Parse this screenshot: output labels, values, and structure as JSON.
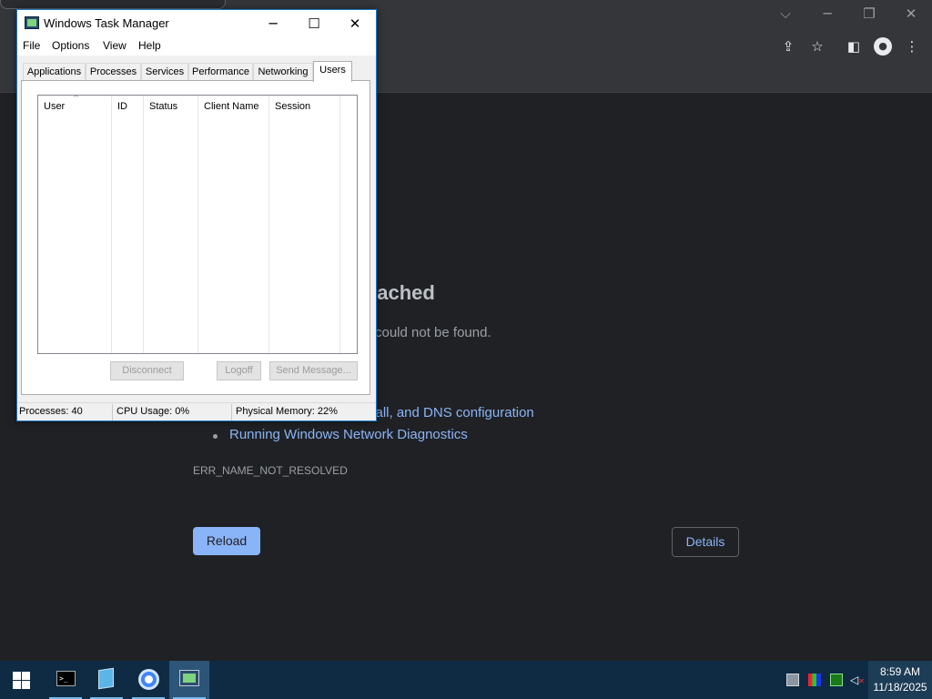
{
  "browser": {
    "window_controls": {
      "chevron": "⌵",
      "minimize": "─",
      "restore": "❐",
      "close": "✕"
    },
    "toolbar_icons": {
      "share": "⇪",
      "star": "☆",
      "sidebar": "◧",
      "profile": "●",
      "menu": "⋮"
    },
    "error": {
      "title_partial": "eached",
      "subtitle_partial": "could not be found.",
      "check_item_partial": "vall, and DNS configuration",
      "diagnostics_link": "Running Windows Network Diagnostics",
      "error_code": "ERR_NAME_NOT_RESOLVED",
      "reload_label": "Reload",
      "details_label": "Details"
    }
  },
  "task_manager": {
    "title": "Windows Task Manager",
    "controls": {
      "minimize": "─",
      "maximize": "☐",
      "close": "✕"
    },
    "menu": [
      "File",
      "Options",
      "View",
      "Help"
    ],
    "tabs": [
      "Applications",
      "Processes",
      "Services",
      "Performance",
      "Networking",
      "Users"
    ],
    "active_tab": "Users",
    "columns": [
      "User",
      "ID",
      "Status",
      "Client Name",
      "Session"
    ],
    "sort_indicator": "^",
    "buttons": {
      "disconnect": "Disconnect",
      "logoff": "Logoff",
      "send_message": "Send Message..."
    },
    "status": {
      "processes": "Processes: 40",
      "cpu": "CPU Usage: 0%",
      "memory": "Physical Memory: 22%"
    }
  },
  "taskbar": {
    "apps": [
      {
        "name": "command-prompt",
        "glyph": ">_"
      },
      {
        "name": "notepad"
      },
      {
        "name": "chrome"
      },
      {
        "name": "task-manager",
        "active": true
      }
    ],
    "clock": {
      "time": "8:59 AM",
      "date": "11/18/2025"
    },
    "colors": {
      "taskbar": "#0f2b44",
      "active_app": "#2c5577",
      "link": "#8ab4f8",
      "accent": "#1979ca"
    }
  }
}
